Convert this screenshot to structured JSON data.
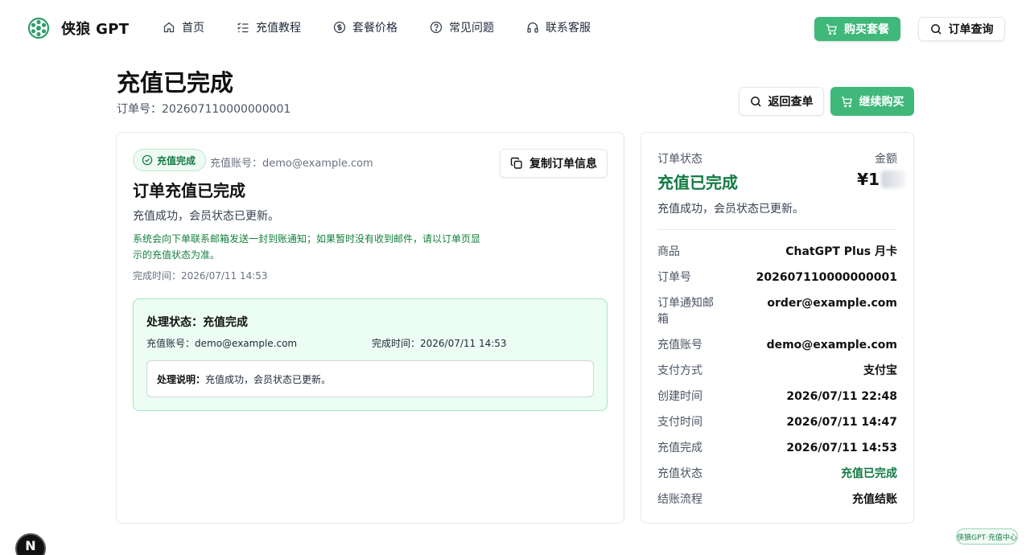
{
  "header": {
    "brand": "侠狼 GPT",
    "nav": [
      {
        "label": "首页",
        "icon": "home-icon"
      },
      {
        "label": "充值教程",
        "icon": "checklist-icon"
      },
      {
        "label": "套餐价格",
        "icon": "dollar-circle-icon"
      },
      {
        "label": "常见问题",
        "icon": "help-circle-icon"
      },
      {
        "label": "联系客服",
        "icon": "headphones-icon"
      }
    ],
    "buy_label": "购买套餐",
    "query_label": "订单查询"
  },
  "page": {
    "title": "充值已完成",
    "order_line": "订单号：202607110000000001",
    "back_label": "返回查单",
    "continue_label": "继续购买"
  },
  "left": {
    "badge": "充值完成",
    "account": "充值账号：demo@example.com",
    "copy_label": "复制订单信息",
    "title": "订单充值已完成",
    "desc": "充值成功，会员状态已更新。",
    "notice": "系统会向下单联系邮箱发送一封到账通知；如果暂时没有收到邮件，请以订单页显示的充值状态为准。",
    "time": "完成时间：2026/07/11 14:53",
    "process": {
      "title": "处理状态：充值完成",
      "account": "充值账号：demo@example.com",
      "time": "完成时间：2026/07/11 14:53",
      "note_label": "处理说明：",
      "note_text": "充值成功，会员状态已更新。"
    }
  },
  "right": {
    "status_label": "订单状态",
    "amount_label": "金额",
    "status": "充值已完成",
    "amount": "¥1",
    "desc": "充值成功，会员状态已更新。",
    "rows": [
      {
        "k": "商品",
        "v": "ChatGPT Plus 月卡"
      },
      {
        "k": "订单号",
        "v": "202607110000000001"
      },
      {
        "k": "订单通知邮箱",
        "v": "order@example.com"
      },
      {
        "k": "充值账号",
        "v": "demo@example.com"
      },
      {
        "k": "支付方式",
        "v": "支付宝"
      },
      {
        "k": "创建时间",
        "v": "2026/07/11 22:48"
      },
      {
        "k": "支付时间",
        "v": "2026/07/11 14:47"
      },
      {
        "k": "充值完成",
        "v": "2026/07/11 14:53"
      },
      {
        "k": "充值状态",
        "v": "充值已完成"
      },
      {
        "k": "结账流程",
        "v": "充值结账"
      }
    ]
  },
  "footer": {
    "nx": "N",
    "tag": "侠狼GPT·充值中心"
  },
  "colors": {
    "accent": "#3fb87a",
    "success_text": "#137a43",
    "success_bg": "#ecfdf3"
  }
}
